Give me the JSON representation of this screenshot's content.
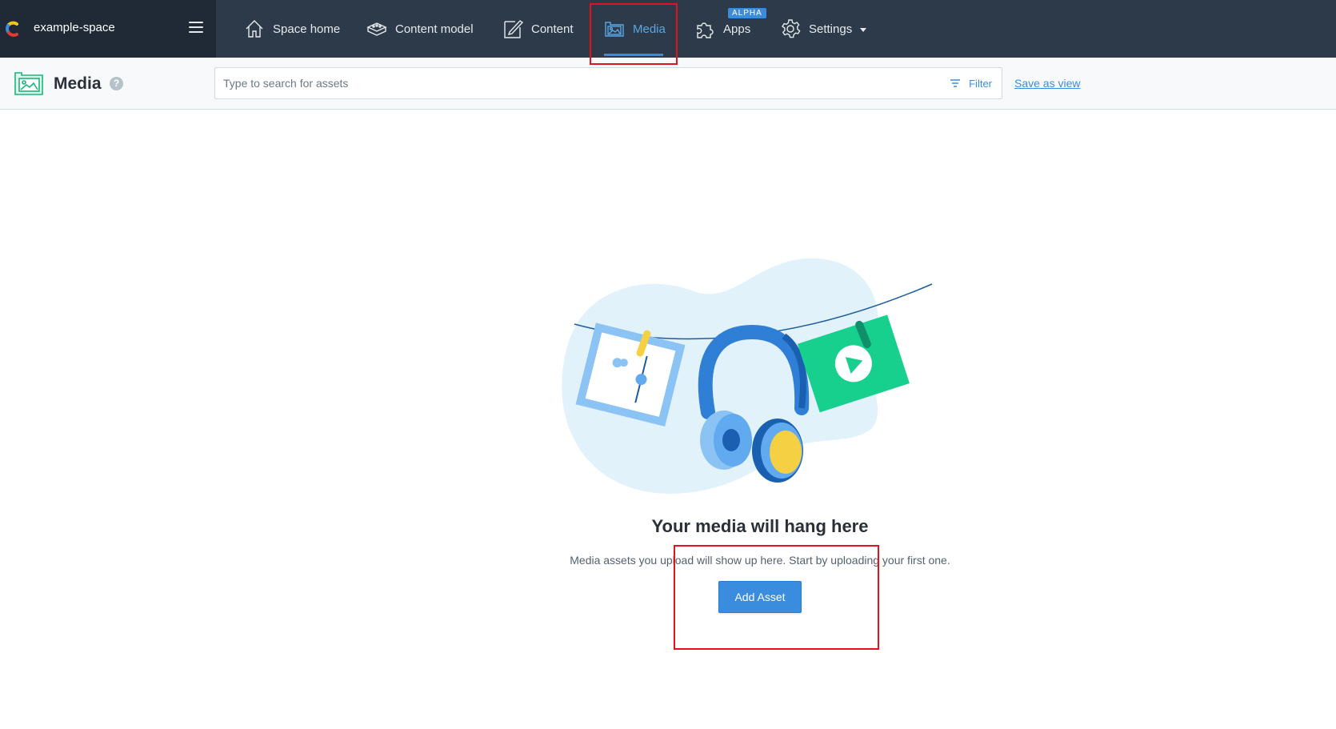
{
  "space": {
    "name": "example-space"
  },
  "nav": {
    "items": [
      {
        "label": "Space home",
        "icon": "home-icon"
      },
      {
        "label": "Content model",
        "icon": "content-model-icon"
      },
      {
        "label": "Content",
        "icon": "content-icon"
      },
      {
        "label": "Media",
        "icon": "media-icon",
        "active": true
      },
      {
        "label": "Apps",
        "icon": "apps-icon",
        "badge": "ALPHA"
      },
      {
        "label": "Settings",
        "icon": "gear-icon",
        "dropdown": true
      }
    ]
  },
  "header": {
    "title": "Media",
    "help": "?",
    "search_placeholder": "Type to search for assets",
    "filter_label": "Filter",
    "save_view_label": "Save as view"
  },
  "empty_state": {
    "title": "Your media will hang here",
    "text": "Media assets you upload will show up here. Start by uploading your first one.",
    "button_label": "Add Asset"
  },
  "colors": {
    "topbar": "#2d3a4a",
    "accent": "#3a8dde",
    "highlight": "#e0141e"
  }
}
